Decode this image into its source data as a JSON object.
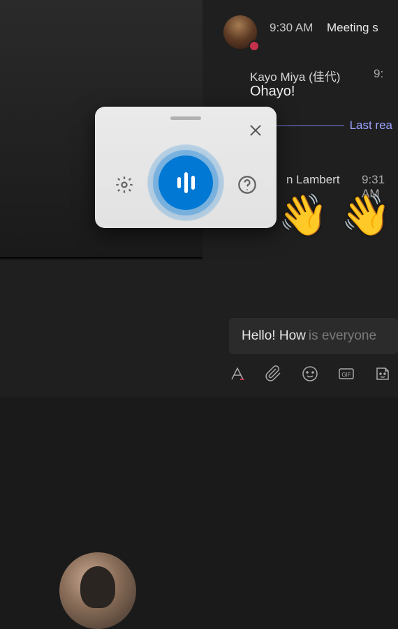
{
  "chat": {
    "messages": [
      {
        "time": "9:30 AM",
        "subject": "Meeting s"
      },
      {
        "name": "Kayo Miya (佳代)",
        "time": "9:",
        "text": "Ohayo!"
      },
      {
        "name": "n Lambert",
        "time": "9:31 AM",
        "emojis": [
          "👋",
          "👋"
        ]
      }
    ],
    "last_read_label": "Last rea"
  },
  "compose": {
    "typed_text": "Hello! How",
    "placeholder_rest": "is everyone"
  },
  "toolbar": {
    "format": "format-icon",
    "attach": "attach-icon",
    "emoji": "emoji-icon",
    "gif": "GIF",
    "sticker": "sticker-icon"
  },
  "dictation": {
    "settings_label": "Settings",
    "help_label": "Help",
    "close_label": "Close",
    "mic_label": "Dictate"
  },
  "colors": {
    "accent": "#0078d4",
    "link": "#9ea2ff",
    "status_busy": "#c4314b"
  }
}
